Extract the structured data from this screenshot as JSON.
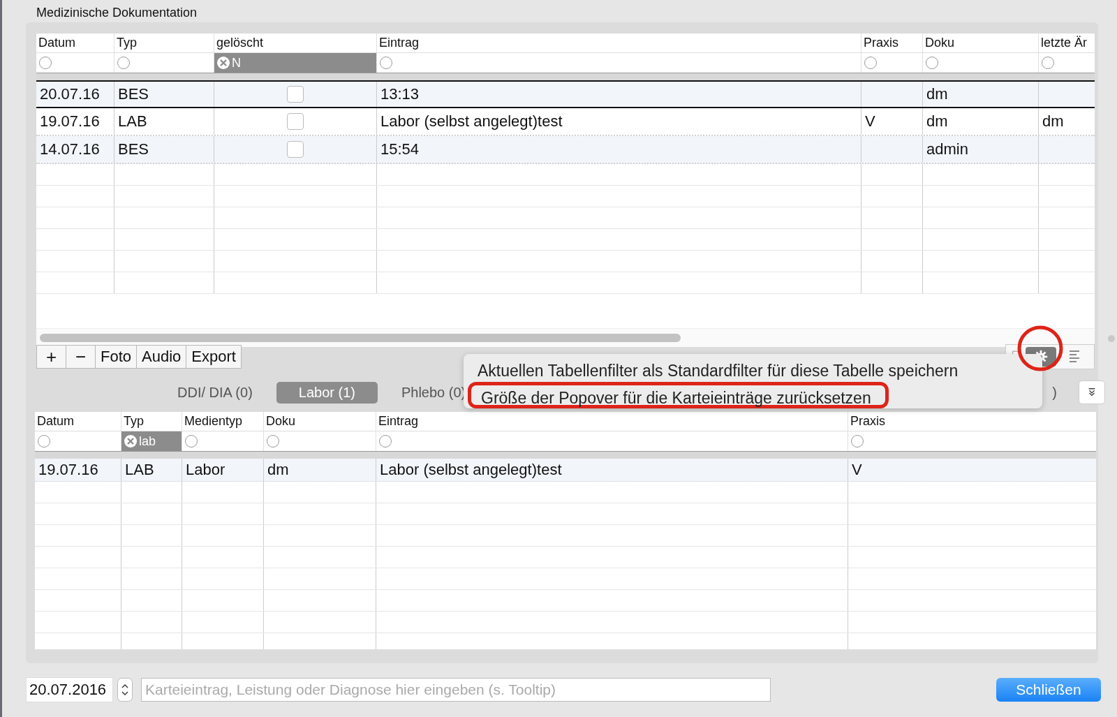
{
  "section_title": "Medizinische Dokumentation",
  "upper_table": {
    "columns": [
      {
        "label": "Datum",
        "filter": {
          "active": false
        }
      },
      {
        "label": "Typ",
        "filter": {
          "active": false
        }
      },
      {
        "label": "gelöscht",
        "filter": {
          "active": true,
          "value": "N"
        }
      },
      {
        "label": "Eintrag",
        "filter": {
          "active": false
        }
      },
      {
        "label": "Praxis",
        "filter": {
          "active": false
        }
      },
      {
        "label": "Doku",
        "filter": {
          "active": false
        }
      },
      {
        "label": "letzte Är",
        "filter": {
          "active": false
        }
      }
    ],
    "rows": [
      {
        "selected": true,
        "datum": "20.07.16",
        "typ": "BES",
        "geloescht": false,
        "eintrag": "13:13",
        "praxis": "",
        "doku": "dm",
        "letzte": ""
      },
      {
        "selected": false,
        "datum": "19.07.16",
        "typ": "LAB",
        "geloescht": false,
        "eintrag": "Labor (selbst angelegt)test",
        "praxis": "V",
        "doku": "dm",
        "letzte": "dm"
      },
      {
        "selected": false,
        "datum": "14.07.16",
        "typ": "BES",
        "geloescht": false,
        "eintrag": "15:54",
        "praxis": "",
        "doku": "admin",
        "letzte": ""
      }
    ]
  },
  "toolbar": {
    "buttons": [
      {
        "kind": "icon",
        "label": "+"
      },
      {
        "kind": "icon",
        "label": "−"
      },
      {
        "kind": "text",
        "label": "Foto"
      },
      {
        "kind": "text",
        "label": "Audio"
      },
      {
        "kind": "text",
        "label": "Export"
      }
    ],
    "settings_open": true
  },
  "tabs": [
    {
      "label": "DDI/ DIA (0)",
      "selected": false
    },
    {
      "label": "Labor (1)",
      "selected": true
    },
    {
      "label": "Phlebo (0)",
      "selected": false
    },
    {
      "label": ")",
      "selected": false
    }
  ],
  "popover": {
    "items": [
      {
        "label": "Aktuellen Tabellenfilter als Standardfilter für diese Tabelle speichern",
        "highlighted": false
      },
      {
        "label": "Größe der Popover für die Karteieinträge zurücksetzen",
        "highlighted": true
      }
    ]
  },
  "lower_table": {
    "columns": [
      {
        "label": "Datum",
        "filter": {
          "active": false
        }
      },
      {
        "label": "Typ",
        "filter": {
          "active": true,
          "value": "lab"
        }
      },
      {
        "label": "Medientyp",
        "filter": {
          "active": false
        }
      },
      {
        "label": "Doku",
        "filter": {
          "active": false
        }
      },
      {
        "label": "Eintrag",
        "filter": {
          "active": false
        }
      },
      {
        "label": "Praxis",
        "filter": {
          "active": false
        }
      }
    ],
    "rows": [
      {
        "cells": [
          "19.07.16",
          "LAB",
          "Labor",
          "dm",
          "Labor (selbst angelegt)test",
          "V"
        ]
      }
    ]
  },
  "bottom": {
    "date": "20.07.2016",
    "entry_placeholder": "Karteieintrag, Leistung oder Diagnose hier eingeben (s. Tooltip)",
    "close_button": "Schließen"
  }
}
